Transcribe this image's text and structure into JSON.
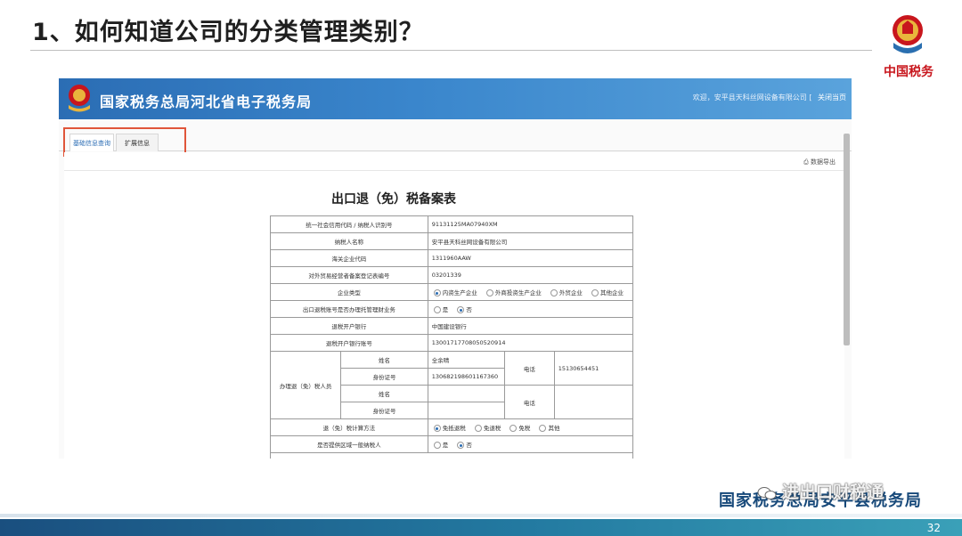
{
  "slide": {
    "title": "1、如何知道公司的分类管理类别？",
    "emblem_text": "中国税务",
    "footer_org": "国家税务总局安平县税务局",
    "watermark": "进出口财税通",
    "page_number": "32"
  },
  "portal": {
    "title": "国家税务总局河北省电子税务局",
    "welcome": "欢迎，安平县天科丝网设备有限公司",
    "close_link": "关闭当页"
  },
  "tabs": [
    {
      "label": "基础信息查询",
      "active": true
    },
    {
      "label": "扩展信息",
      "active": false
    }
  ],
  "export_label": "数据导出",
  "form": {
    "title": "出口退（免）税备案表",
    "rows": {
      "credit_code_label": "统一社会信用代码 / 纳税人识别号",
      "credit_code_value": "91131125MA07940XM",
      "taxpayer_name_label": "纳税人名称",
      "taxpayer_name_value": "安平县天科丝网设备有限公司",
      "customs_code_label": "海关企业代码",
      "customs_code_value": "1311960AAW",
      "foreign_trade_label": "对外贸易经营者备案登记表编号",
      "foreign_trade_value": "03201339",
      "enterprise_type_label": "企业类型",
      "enterprise_type_options": [
        "内资生产企业",
        "外商投资生产企业",
        "外贸企业",
        "其他企业"
      ],
      "enterprise_type_selected": 0,
      "entrusted_label": "出口退税账号是否办理托管理财业务",
      "yes": "是",
      "no": "否",
      "bank_label": "退税开户银行",
      "bank_value": "中国建设银行",
      "account_label": "退税开户银行账号",
      "account_value": "13001717708050520914",
      "agent_label": "办理退（免）税人员",
      "name_label": "姓名",
      "id_label": "身份证号",
      "phone_label": "电话",
      "agent1_name": "全余晴",
      "agent1_id": "130682198601167360",
      "agent1_phone": "15130654451",
      "method_label": "退（免）税计算方法",
      "method_options": [
        "免抵退税",
        "免退税",
        "免税",
        "其他"
      ],
      "method_selected": 0,
      "zone_label": "是否提供区域一般纳税人"
    }
  }
}
